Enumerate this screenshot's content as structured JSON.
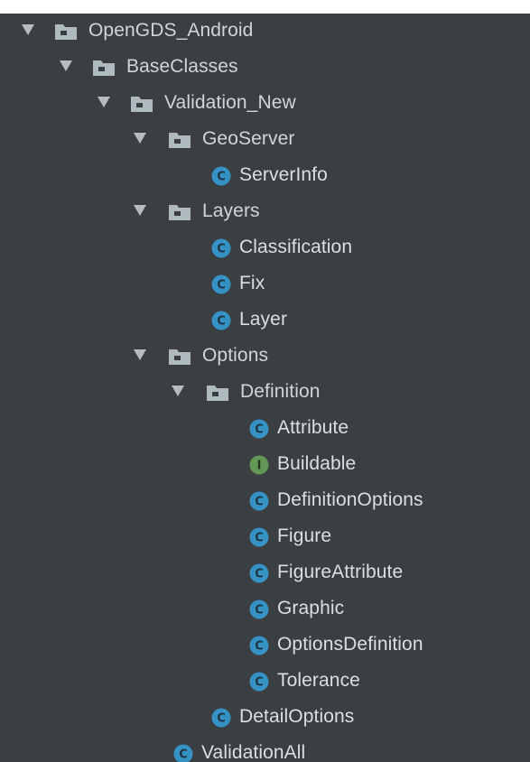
{
  "tree": {
    "items": [
      {
        "label": "OpenGDS_Android",
        "kind": "folder",
        "icon": "folder-icon"
      },
      {
        "label": "BaseClasses",
        "kind": "folder",
        "icon": "folder-icon"
      },
      {
        "label": "Validation_New",
        "kind": "folder",
        "icon": "folder-icon"
      },
      {
        "label": "GeoServer",
        "kind": "folder",
        "icon": "folder-icon"
      },
      {
        "label": "ServerInfo",
        "kind": "class",
        "icon": "class-icon"
      },
      {
        "label": "Layers",
        "kind": "folder",
        "icon": "folder-icon"
      },
      {
        "label": "Classification",
        "kind": "class",
        "icon": "class-icon"
      },
      {
        "label": "Fix",
        "kind": "class",
        "icon": "class-icon"
      },
      {
        "label": "Layer",
        "kind": "class",
        "icon": "class-icon"
      },
      {
        "label": "Options",
        "kind": "folder",
        "icon": "folder-icon"
      },
      {
        "label": "Definition",
        "kind": "folder",
        "icon": "folder-icon"
      },
      {
        "label": "Attribute",
        "kind": "class",
        "icon": "class-icon"
      },
      {
        "label": "Buildable",
        "kind": "interface",
        "icon": "interface-icon"
      },
      {
        "label": "DefinitionOptions",
        "kind": "class",
        "icon": "class-icon"
      },
      {
        "label": "Figure",
        "kind": "class",
        "icon": "class-icon"
      },
      {
        "label": "FigureAttribute",
        "kind": "class",
        "icon": "class-icon"
      },
      {
        "label": "Graphic",
        "kind": "class",
        "icon": "class-icon"
      },
      {
        "label": "OptionsDefinition",
        "kind": "class",
        "icon": "class-icon"
      },
      {
        "label": "Tolerance",
        "kind": "class",
        "icon": "class-icon"
      },
      {
        "label": "DetailOptions",
        "kind": "class",
        "icon": "class-icon"
      },
      {
        "label": "ValidationAll",
        "kind": "class",
        "icon": "class-icon"
      }
    ],
    "icon_letters": {
      "class": "C",
      "interface": "I"
    }
  },
  "colors": {
    "background": "#3c3f41",
    "text": "#d2d4d6",
    "arrow": "#b9bcbf",
    "class_icon": "#3592c4",
    "interface_icon": "#629755",
    "folder_icon": "#aeb9c0"
  }
}
